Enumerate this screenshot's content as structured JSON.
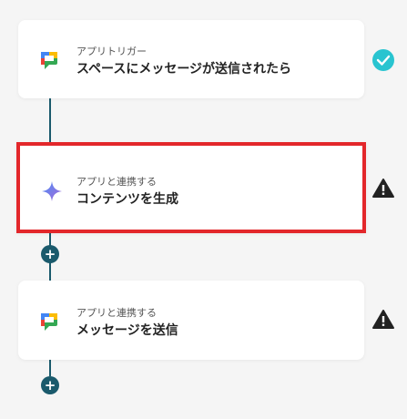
{
  "flow": {
    "steps": [
      {
        "label": "アプリトリガー",
        "title": "スペースにメッセージが送信されたら",
        "icon": "google-chat-icon",
        "status": "check-icon"
      },
      {
        "label": "アプリと連携する",
        "title": "コンテンツを生成",
        "icon": "gemini-sparkle-icon",
        "status": "warning-icon"
      },
      {
        "label": "アプリと連携する",
        "title": "メッセージを送信",
        "icon": "google-chat-icon",
        "status": "warning-icon"
      }
    ],
    "add_label": "+"
  },
  "colors": {
    "connector": "#1a5a6c",
    "highlight_border": "#e3272b",
    "check": "#29c4d0",
    "warning": "#222222"
  }
}
